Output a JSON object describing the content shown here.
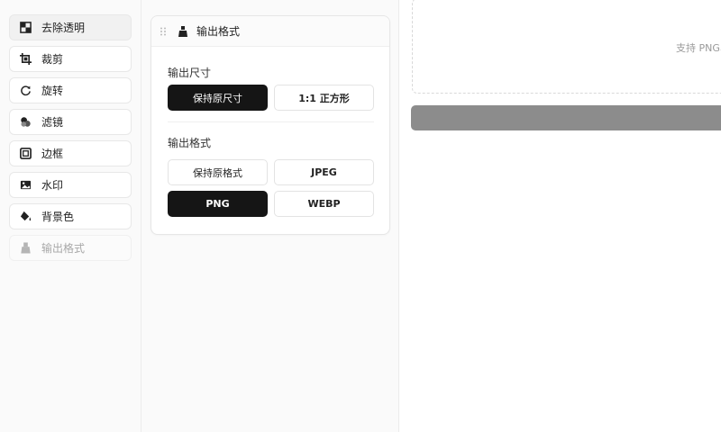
{
  "sidebar": {
    "items": [
      {
        "label": "去除透明",
        "icon": "transparency-icon"
      },
      {
        "label": "裁剪",
        "icon": "crop-icon"
      },
      {
        "label": "旋转",
        "icon": "rotate-icon"
      },
      {
        "label": "滤镜",
        "icon": "filter-icon"
      },
      {
        "label": "边框",
        "icon": "border-icon"
      },
      {
        "label": "水印",
        "icon": "watermark-icon"
      },
      {
        "label": "背景色",
        "icon": "paint-bucket-icon"
      },
      {
        "label": "输出格式",
        "icon": "output-icon"
      }
    ]
  },
  "panel": {
    "title": "输出格式",
    "size_section": {
      "label": "输出尺寸",
      "options": [
        "保持原尺寸",
        "1:1 正方形"
      ],
      "selected": "保持原尺寸"
    },
    "format_section": {
      "label": "输出格式",
      "options": [
        "保持原格式",
        "JPEG",
        "PNG",
        "WEBP"
      ],
      "selected": "PNG"
    }
  },
  "dropzone": {
    "hint": "支持 PNG、J"
  },
  "colors": {
    "selected": "#151515",
    "action_bar": "#8c8c8c"
  }
}
